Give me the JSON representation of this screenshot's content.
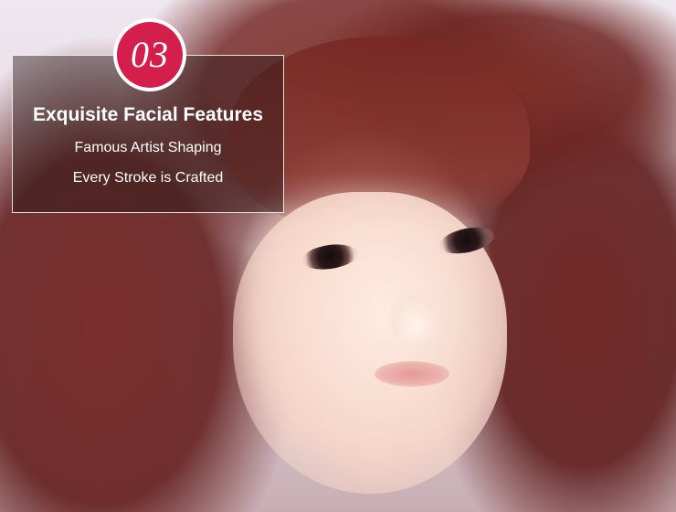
{
  "badge": {
    "number": "03"
  },
  "feature": {
    "title": "Exquisite Facial Features",
    "lines": [
      "Famous Artist Shaping",
      "Every Stroke is Crafted"
    ]
  },
  "colors": {
    "badge_accent": "#d41e4c",
    "panel_overlay": "rgba(40,24,24,0.45)",
    "text": "#ffffff"
  }
}
